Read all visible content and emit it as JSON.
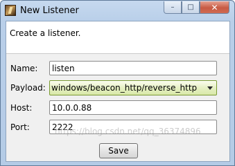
{
  "window": {
    "title": "New Listener",
    "minimize_glyph": "–",
    "maximize_glyph": "□",
    "close_glyph": "✕"
  },
  "form": {
    "description": "Create a listener.",
    "name_label": "Name:",
    "name_value": "listen",
    "payload_label": "Payload:",
    "payload_value": "windows/beacon_http/reverse_http",
    "host_label": "Host:",
    "host_value": "10.0.0.88",
    "port_label": "Port:",
    "port_value": "2222",
    "save_label": "Save"
  },
  "watermark": "https://blog.csdn.net/qq_36374896",
  "colors": {
    "titlebar": "#b9cfe9",
    "select_highlight": "#e6f0c4",
    "close_button": "#c75a43"
  }
}
